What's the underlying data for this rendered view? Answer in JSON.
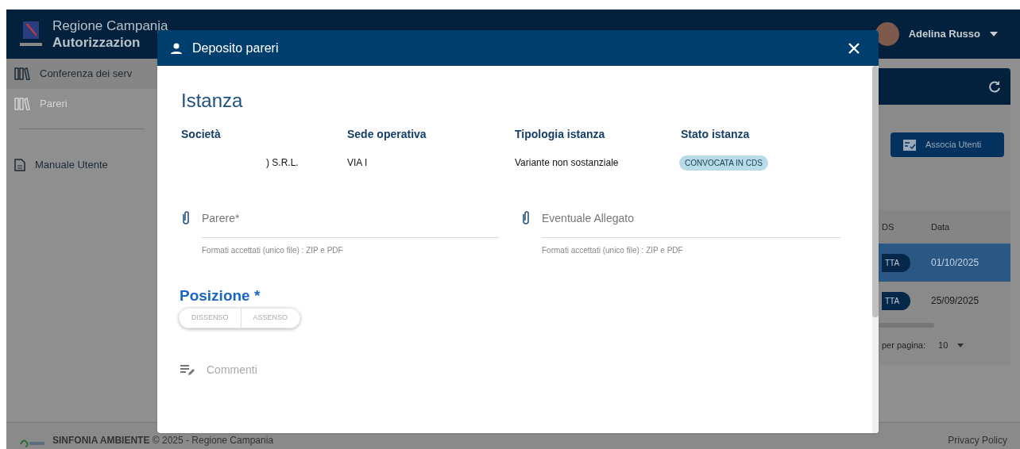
{
  "header": {
    "title": "Regione Campania",
    "subtitle": "Autorizzazion",
    "user": "Adelina Russo"
  },
  "sidebar": {
    "items": [
      {
        "label": "Conferenza dei serv",
        "disabled": false
      },
      {
        "label": "Pareri",
        "disabled": true
      },
      {
        "label": "Manuale Utente",
        "disabled": false
      }
    ]
  },
  "main": {
    "button": "Associa Utenti",
    "table": {
      "columns": [
        "DS",
        "Data"
      ],
      "rows": [
        {
          "status": "TTA",
          "date": "01/10/2025",
          "selected": true
        },
        {
          "status": "TTA",
          "date": "25/09/2025",
          "selected": false
        }
      ]
    },
    "pagination": {
      "label": "per pagina:",
      "value": "10"
    }
  },
  "footer": {
    "text": "**SINFONIA AMBIENTE** © 2025 - Regione Campania",
    "link": "Privacy Policy"
  },
  "dialog": {
    "title": "Deposito pareri",
    "section": "Istanza",
    "fields": [
      {
        "label": "Società",
        "value": ") S.R.L.",
        "kind": "text"
      },
      {
        "label": "Sede operativa",
        "value": "VIA I",
        "kind": "text"
      },
      {
        "label": "Tipologia istanza",
        "value": "Variante non sostanziale",
        "kind": "text"
      },
      {
        "label": "Stato istanza",
        "value": "CONVOCATA IN CDS",
        "kind": "badge"
      }
    ],
    "uploads": [
      {
        "label": "Parere*",
        "hint": "Formati accettati (unico file) : ZIP e PDF"
      },
      {
        "label": "Eventuale Allegato",
        "hint": "Formati accettati (unico file) : ZIP e PDF"
      }
    ],
    "position": {
      "label": "Posizione *",
      "options": [
        {
          "label": "DISSENSO",
          "selected": false
        },
        {
          "label": "ASSENSO",
          "selected": false
        }
      ]
    },
    "comments": {
      "placeholder": "Commenti"
    }
  }
}
